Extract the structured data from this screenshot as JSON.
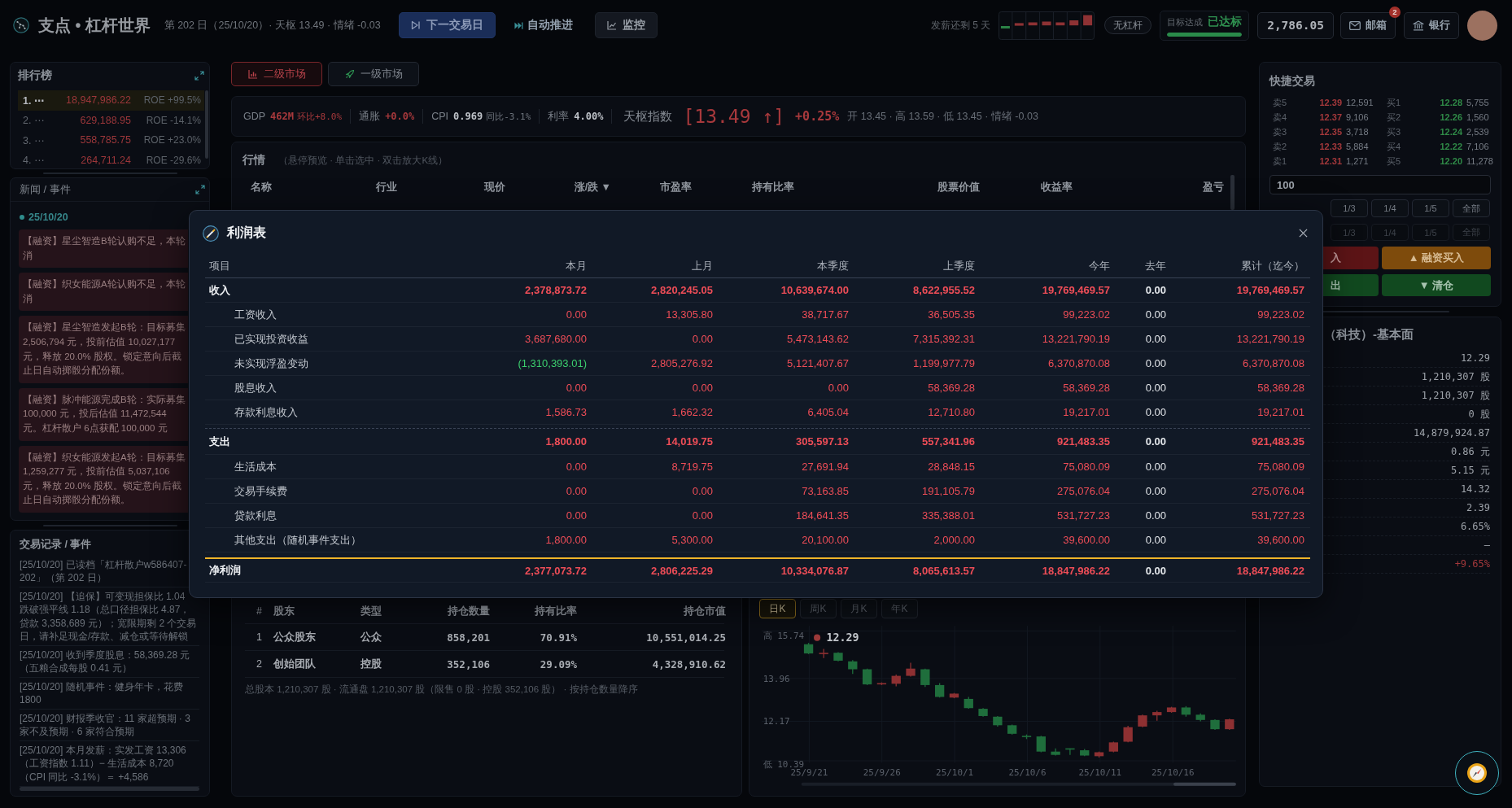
{
  "top_bar": {
    "brand": "支点 • 杠杆世界",
    "status": "第 202 日（25/10/20）· 天枢 13.49 · 情绪 -0.03",
    "actions": [
      {
        "label": "下一交易日",
        "kind": "primary"
      },
      {
        "label": "自动推进",
        "kind": "plain"
      },
      {
        "label": "监控",
        "kind": "secondary"
      }
    ],
    "payday": "发薪还剩 5 天",
    "leverage": "无杠杆",
    "goal": {
      "label": "目标达成",
      "status": "已达标",
      "level": 1
    },
    "balance": "2,786.05",
    "mail": {
      "label": "邮箱",
      "badge": "2"
    },
    "bank": {
      "label": "银行"
    }
  },
  "rankings": {
    "title": "排行榜",
    "rows": [
      {
        "rank": "1. ⋯",
        "value": "18,947,986.22",
        "roe": "ROE +99.5%",
        "selected": true
      },
      {
        "rank": "2. ⋯",
        "value": "629,188.95",
        "roe": "ROE -14.1%",
        "selected": false
      },
      {
        "rank": "3. ⋯",
        "value": "558,785.75",
        "roe": "ROE +23.0%",
        "selected": false
      },
      {
        "rank": "4. ⋯",
        "value": "264,711.24",
        "roe": "ROE -29.6%",
        "selected": false
      }
    ]
  },
  "news": {
    "title": "新闻 / 事件",
    "date": "25/10/20",
    "items": [
      "【融资】星尘智造B轮认购不足，本轮消",
      "【融资】织女能源A轮认购不足，本轮消",
      "【融资】星尘智造发起B轮：目标募集 2,506,794 元，投前估值 10,027,177 元，释放 20.0% 股权。锁定意向后截止日自动掷骰分配份额。",
      "【融资】脉冲能源完成B轮：实际募集 100,000 元，投后估值 11,472,544 元。杠杆散户 6点获配 100,000 元",
      "【融资】织女能源发起A轮：目标募集 1,259,277 元，投前估值 5,037,106 元，释放 20.0% 股权。锁定意向后截止日自动掷骰分配份额。"
    ]
  },
  "trade_log": {
    "title": "交易记录 / 事件",
    "entries": [
      "[25/10/20] 已读档「杠杆散户w586407-202」（第 202 日）",
      "[25/10/20] 【追保】可变现担保比 1.04 跌破强平线 1.18（总口径担保比 4.87，贷款 3,358,689 元）；宽限期剩 2 个交易日，请补足现金/存款、减仓或等待解锁",
      "[25/10/20] 收到季度股息：58,369.28 元（五粮合成每股 0.41 元）",
      "[25/10/20] 随机事件：健身年卡，花费 1800",
      "[25/10/20] 财报季收官：11 家超预期 · 3 家不及预期 · 6 家符合预期",
      "[25/10/20] 本月发薪：实发工资 13,306（工资指数 1.11）− 生活成本 8,720（CPI 同比 -3.1%）＝ +4,586"
    ]
  },
  "market_tabs": [
    {
      "label": "二级市场",
      "selected": true
    },
    {
      "label": "一级市场",
      "selected": false
    }
  ],
  "indicators": [
    {
      "label": "GDP",
      "value": {
        "text": "462M",
        "kind": "up"
      },
      "change": {
        "text": "环比+8.0%",
        "kind": "up"
      }
    },
    {
      "label": "通胀",
      "value": {
        "text": "+0.0%",
        "kind": "up"
      }
    },
    {
      "label": "CPI",
      "value": {
        "text": "0.969",
        "kind": "flat"
      },
      "change": {
        "text": "同比-3.1%",
        "kind": "flat"
      }
    },
    {
      "label": "利率",
      "value": {
        "text": "4.00%",
        "kind": "flat"
      }
    }
  ],
  "index": {
    "label": "天枢指数",
    "value": "[13.49 ↑]",
    "change": "+0.25%",
    "kind": "up",
    "details": "开 13.45 · 高 13.59 · 低 13.45 · 情绪 -0.03"
  },
  "market": {
    "title": "行情",
    "hint": "（悬停预览 · 单击选中 · 双击放大K线）",
    "columns": [
      "名称",
      "行业",
      "现价",
      "涨/跌 ▼",
      "市盈率",
      "持有比率",
      "股票价值",
      "收益率",
      "盈亏"
    ]
  },
  "shareholders": {
    "columns": [
      "#",
      "股东",
      "类型",
      "持仓数量",
      "持有比率",
      "持仓市值"
    ],
    "rows": [
      [
        "1",
        "公众股东",
        "公众",
        "858,201",
        "70.91%",
        "10,551,014.25"
      ],
      [
        "2",
        "创始团队",
        "控股",
        "352,106",
        "29.09%",
        "4,328,910.62"
      ]
    ],
    "footer": "总股本 1,210,307 股 · 流通盘 1,210,307 股（限售 0 股 · 控股 352,106 股） · 按持仓数量降序"
  },
  "kline": {
    "periods": [
      {
        "label": "日K",
        "selected": true
      },
      {
        "label": "周K",
        "selected": false
      },
      {
        "label": "月K",
        "selected": false
      },
      {
        "label": "年K",
        "selected": false
      }
    ],
    "y_labels": [
      "高 15.74",
      "13.96",
      "12.17",
      "低 10.39"
    ],
    "x_labels": [
      "25/9/21",
      "25/9/26",
      "25/10/1",
      "25/10/6",
      "25/10/11",
      "25/10/16"
    ],
    "last_price": "12.29"
  },
  "quick_trade": {
    "title": "快捷交易",
    "asks": [
      {
        "label": "卖5",
        "price": "12.39",
        "volume": "12,591"
      },
      {
        "label": "卖4",
        "price": "12.37",
        "volume": "9,106"
      },
      {
        "label": "卖3",
        "price": "12.35",
        "volume": "3,718"
      },
      {
        "label": "卖2",
        "price": "12.33",
        "volume": "5,884"
      },
      {
        "label": "卖1",
        "price": "12.31",
        "volume": "1,271"
      }
    ],
    "bids": [
      {
        "label": "买1",
        "price": "12.28",
        "volume": "5,755"
      },
      {
        "label": "买2",
        "price": "12.26",
        "volume": "1,560"
      },
      {
        "label": "买3",
        "price": "12.24",
        "volume": "2,539"
      },
      {
        "label": "买4",
        "price": "12.22",
        "volume": "7,106"
      },
      {
        "label": "买5",
        "price": "12.20",
        "volume": "11,278"
      }
    ],
    "quantity": "100",
    "fraction_rows": [
      {
        "disabled": false,
        "options": [
          "1/3",
          "1/4",
          "1/5",
          "全部"
        ]
      },
      {
        "disabled": true,
        "options": [
          "1/3",
          "1/4",
          "1/5",
          "全部"
        ]
      }
    ],
    "actions": [
      {
        "label": "入",
        "kind": "buy"
      },
      {
        "label": "▲ 融资买入",
        "kind": "margin"
      },
      {
        "label": "出",
        "kind": "sell"
      },
      {
        "label": "▼ 清仓",
        "kind": "clear"
      }
    ]
  },
  "fundamentals": {
    "title": "（科技）-基本面",
    "values": [
      {
        "text": "12.29",
        "kind": "plain"
      },
      {
        "text": "1,210,307 股",
        "kind": "plain"
      },
      {
        "text": "1,210,307 股",
        "kind": "plain"
      },
      {
        "text": "0 股",
        "kind": "plain"
      },
      {
        "text": "14,879,924.87",
        "kind": "plain"
      },
      {
        "text": "0.86 元",
        "kind": "plain"
      },
      {
        "text": "5.15 元",
        "kind": "plain"
      },
      {
        "text": "14.32",
        "kind": "plain"
      },
      {
        "text": "2.39",
        "kind": "plain"
      },
      {
        "text": "6.65%",
        "kind": "plain"
      },
      {
        "text": "—",
        "kind": "plain"
      },
      {
        "text": "+9.65%",
        "kind": "up"
      }
    ]
  },
  "income_statement": {
    "title": "利润表",
    "columns": [
      "项目",
      "本月",
      "上月",
      "本季度",
      "上季度",
      "今年",
      "去年",
      "累计（迄今）"
    ],
    "rows": [
      {
        "kind": "section",
        "cells": [
          {
            "text": "收入",
            "kind": "label"
          },
          {
            "text": "2,378,873.72",
            "kind": "up"
          },
          {
            "text": "2,820,245.05",
            "kind": "up"
          },
          {
            "text": "10,639,674.00",
            "kind": "up"
          },
          {
            "text": "8,622,955.52",
            "kind": "up"
          },
          {
            "text": "19,769,469.57",
            "kind": "up"
          },
          {
            "text": "0.00",
            "kind": "flat"
          },
          {
            "text": "19,769,469.57",
            "kind": "up"
          }
        ]
      },
      {
        "kind": "item",
        "cells": [
          {
            "text": "工资收入",
            "kind": "label"
          },
          {
            "text": "0.00",
            "kind": "up"
          },
          {
            "text": "13,305.80",
            "kind": "up"
          },
          {
            "text": "38,717.67",
            "kind": "up"
          },
          {
            "text": "36,505.35",
            "kind": "up"
          },
          {
            "text": "99,223.02",
            "kind": "up"
          },
          {
            "text": "0.00",
            "kind": "flat"
          },
          {
            "text": "99,223.02",
            "kind": "up"
          }
        ]
      },
      {
        "kind": "item",
        "cells": [
          {
            "text": "已实现投资收益",
            "kind": "label"
          },
          {
            "text": "3,687,680.00",
            "kind": "up"
          },
          {
            "text": "0.00",
            "kind": "up"
          },
          {
            "text": "5,473,143.62",
            "kind": "up"
          },
          {
            "text": "7,315,392.31",
            "kind": "up"
          },
          {
            "text": "13,221,790.19",
            "kind": "up"
          },
          {
            "text": "0.00",
            "kind": "flat"
          },
          {
            "text": "13,221,790.19",
            "kind": "up"
          }
        ]
      },
      {
        "kind": "item",
        "cells": [
          {
            "text": "未实现浮盈变动",
            "kind": "label"
          },
          {
            "text": "(1,310,393.01)",
            "kind": "down"
          },
          {
            "text": "2,805,276.92",
            "kind": "up"
          },
          {
            "text": "5,121,407.67",
            "kind": "up"
          },
          {
            "text": "1,199,977.79",
            "kind": "up"
          },
          {
            "text": "6,370,870.08",
            "kind": "up"
          },
          {
            "text": "0.00",
            "kind": "flat"
          },
          {
            "text": "6,370,870.08",
            "kind": "up"
          }
        ]
      },
      {
        "kind": "item",
        "cells": [
          {
            "text": "股息收入",
            "kind": "label"
          },
          {
            "text": "0.00",
            "kind": "up"
          },
          {
            "text": "0.00",
            "kind": "up"
          },
          {
            "text": "0.00",
            "kind": "up"
          },
          {
            "text": "58,369.28",
            "kind": "up"
          },
          {
            "text": "58,369.28",
            "kind": "up"
          },
          {
            "text": "0.00",
            "kind": "flat"
          },
          {
            "text": "58,369.28",
            "kind": "up"
          }
        ]
      },
      {
        "kind": "item",
        "cells": [
          {
            "text": "存款利息收入",
            "kind": "label"
          },
          {
            "text": "1,586.73",
            "kind": "up"
          },
          {
            "text": "1,662.32",
            "kind": "up"
          },
          {
            "text": "6,405.04",
            "kind": "up"
          },
          {
            "text": "12,710.80",
            "kind": "up"
          },
          {
            "text": "19,217.01",
            "kind": "up"
          },
          {
            "text": "0.00",
            "kind": "flat"
          },
          {
            "text": "19,217.01",
            "kind": "up"
          }
        ]
      },
      {
        "kind": "section",
        "cells": [
          {
            "text": "支出",
            "kind": "label"
          },
          {
            "text": "1,800.00",
            "kind": "up"
          },
          {
            "text": "14,019.75",
            "kind": "up"
          },
          {
            "text": "305,597.13",
            "kind": "up"
          },
          {
            "text": "557,341.96",
            "kind": "up"
          },
          {
            "text": "921,483.35",
            "kind": "up"
          },
          {
            "text": "0.00",
            "kind": "flat"
          },
          {
            "text": "921,483.35",
            "kind": "up"
          }
        ]
      },
      {
        "kind": "item",
        "cells": [
          {
            "text": "生活成本",
            "kind": "label"
          },
          {
            "text": "0.00",
            "kind": "up"
          },
          {
            "text": "8,719.75",
            "kind": "up"
          },
          {
            "text": "27,691.94",
            "kind": "up"
          },
          {
            "text": "28,848.15",
            "kind": "up"
          },
          {
            "text": "75,080.09",
            "kind": "up"
          },
          {
            "text": "0.00",
            "kind": "flat"
          },
          {
            "text": "75,080.09",
            "kind": "up"
          }
        ]
      },
      {
        "kind": "item",
        "cells": [
          {
            "text": "交易手续费",
            "kind": "label"
          },
          {
            "text": "0.00",
            "kind": "up"
          },
          {
            "text": "0.00",
            "kind": "up"
          },
          {
            "text": "73,163.85",
            "kind": "up"
          },
          {
            "text": "191,105.79",
            "kind": "up"
          },
          {
            "text": "275,076.04",
            "kind": "up"
          },
          {
            "text": "0.00",
            "kind": "flat"
          },
          {
            "text": "275,076.04",
            "kind": "up"
          }
        ]
      },
      {
        "kind": "item",
        "cells": [
          {
            "text": "贷款利息",
            "kind": "label"
          },
          {
            "text": "0.00",
            "kind": "up"
          },
          {
            "text": "0.00",
            "kind": "up"
          },
          {
            "text": "184,641.35",
            "kind": "up"
          },
          {
            "text": "335,388.01",
            "kind": "up"
          },
          {
            "text": "531,727.23",
            "kind": "up"
          },
          {
            "text": "0.00",
            "kind": "flat"
          },
          {
            "text": "531,727.23",
            "kind": "up"
          }
        ]
      },
      {
        "kind": "item",
        "cells": [
          {
            "text": "其他支出（随机事件支出）",
            "kind": "label"
          },
          {
            "text": "1,800.00",
            "kind": "up"
          },
          {
            "text": "5,300.00",
            "kind": "up"
          },
          {
            "text": "20,100.00",
            "kind": "up"
          },
          {
            "text": "2,000.00",
            "kind": "up"
          },
          {
            "text": "39,600.00",
            "kind": "up"
          },
          {
            "text": "0.00",
            "kind": "flat"
          },
          {
            "text": "39,600.00",
            "kind": "up"
          }
        ]
      },
      {
        "kind": "total",
        "cells": [
          {
            "text": "净利润",
            "kind": "label"
          },
          {
            "text": "2,377,073.72",
            "kind": "up"
          },
          {
            "text": "2,806,225.29",
            "kind": "up"
          },
          {
            "text": "10,334,076.87",
            "kind": "up"
          },
          {
            "text": "8,065,613.57",
            "kind": "up"
          },
          {
            "text": "18,847,986.22",
            "kind": "up"
          },
          {
            "text": "0.00",
            "kind": "flat"
          },
          {
            "text": "18,847,986.22",
            "kind": "up"
          }
        ]
      }
    ]
  }
}
